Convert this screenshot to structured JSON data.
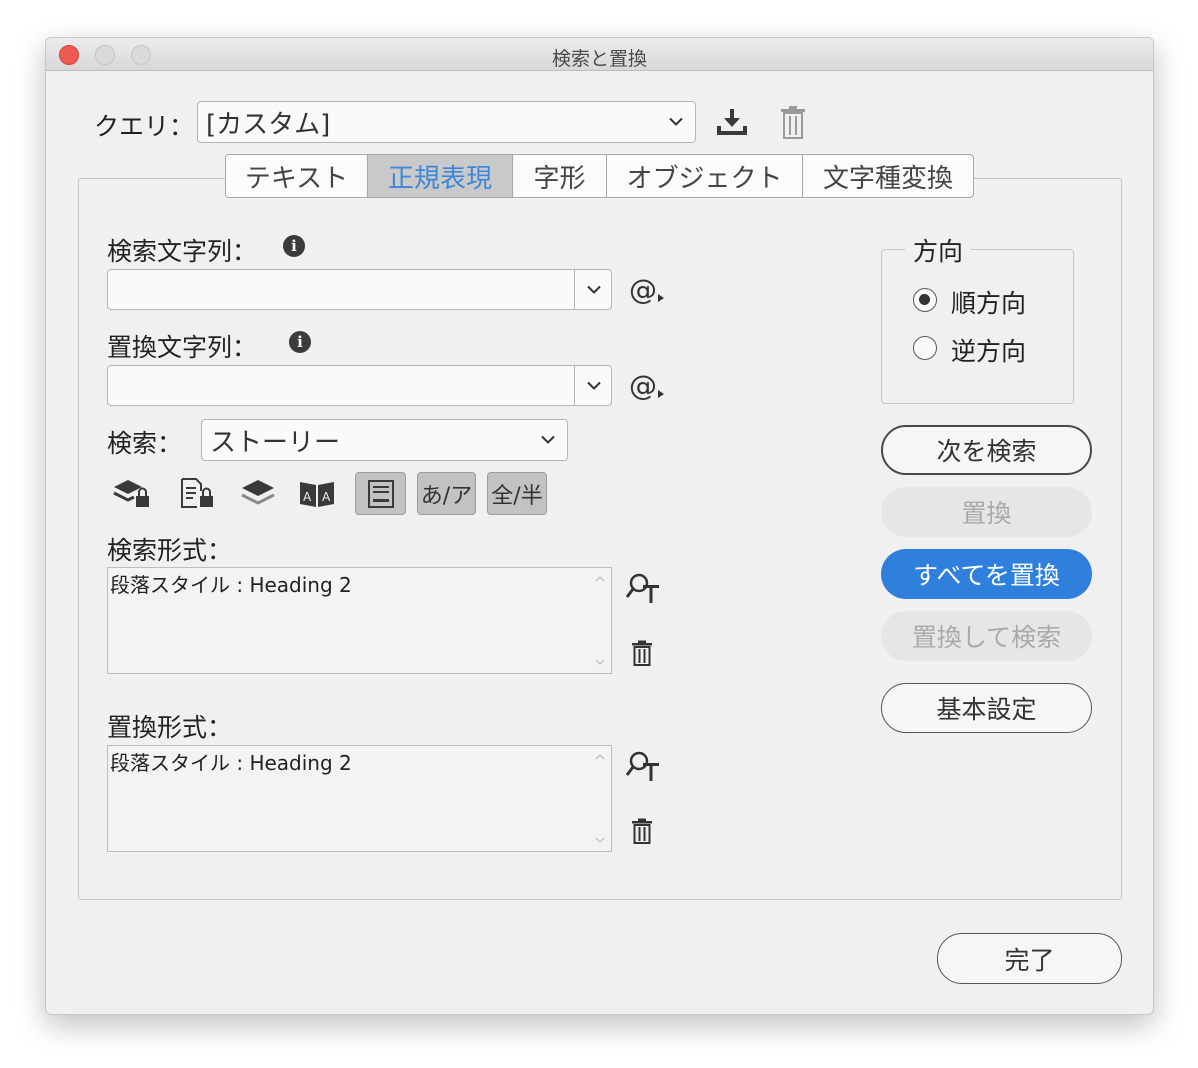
{
  "window": {
    "title": "検索と置換"
  },
  "query": {
    "label": "クエリ：",
    "value": "[カスタム]"
  },
  "tabs": [
    {
      "label": "テキスト",
      "active": false
    },
    {
      "label": "正規表現",
      "active": true
    },
    {
      "label": "字形",
      "active": false
    },
    {
      "label": "オブジェクト",
      "active": false
    },
    {
      "label": "文字種変換",
      "active": false
    }
  ],
  "find": {
    "label": "検索文字列：",
    "value": ""
  },
  "replace": {
    "label": "置換文字列：",
    "value": ""
  },
  "search_scope": {
    "label": "検索：",
    "value": "ストーリー"
  },
  "options": {
    "kana_label": "あ/ア",
    "width_label": "全/半"
  },
  "find_format": {
    "label": "検索形式：",
    "value": "段落スタイル : Heading 2"
  },
  "replace_format": {
    "label": "置換形式：",
    "value": "段落スタイル : Heading 2"
  },
  "direction": {
    "title": "方向",
    "forward": "順方向",
    "backward": "逆方向",
    "selected": "forward"
  },
  "buttons": {
    "find_next": "次を検索",
    "replace": "置換",
    "replace_all": "すべてを置換",
    "replace_find": "置換して検索",
    "more_options": "基本設定",
    "done": "完了"
  },
  "colors": {
    "accent": "#2f7fdd",
    "active_tab_text": "#3d87da"
  }
}
